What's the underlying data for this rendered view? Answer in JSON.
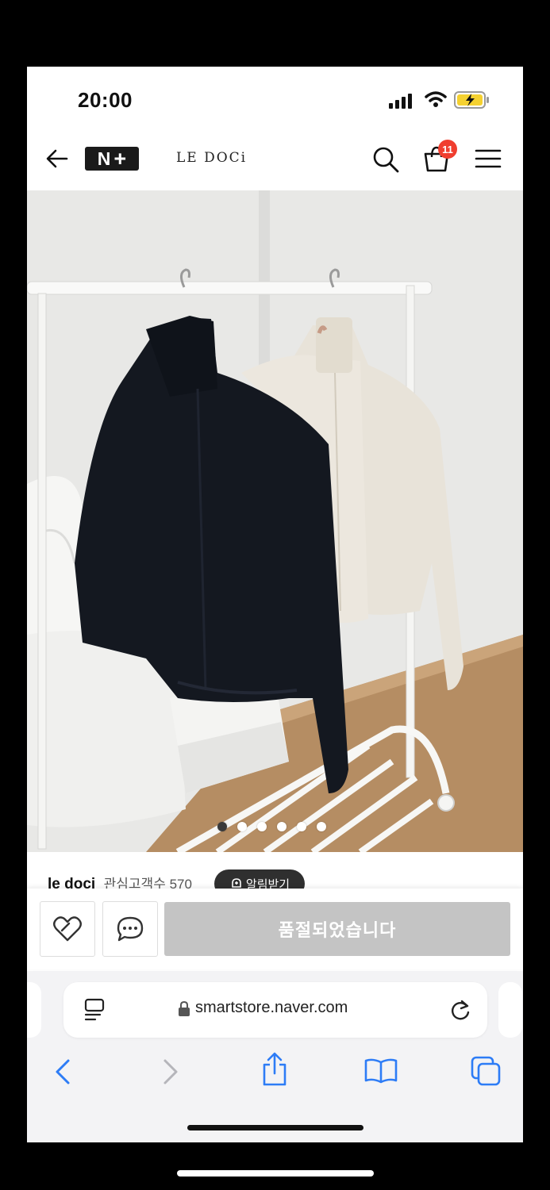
{
  "status_bar": {
    "time": "20:00",
    "battery": "charging"
  },
  "header": {
    "back_icon": "arrow-left-icon",
    "logo_n": "N",
    "logo_plus": "+",
    "brand": "LE DOCi",
    "cart_count": "11",
    "icons": [
      "search-icon",
      "cart-icon",
      "menu-icon"
    ]
  },
  "product": {
    "image_description": "navy and beige jackets on clothing rack",
    "carousel_total": 6,
    "carousel_active": 1
  },
  "seller": {
    "name": "le doci",
    "follower_label": "관심고객수 570",
    "alarm_label": "알림받기"
  },
  "purchase_bar": {
    "soldout_label": "품절되었습니다",
    "icons": [
      "heart-icon",
      "chat-icon"
    ]
  },
  "browser": {
    "url": "smartstore.naver.com",
    "icons": [
      "page-menu-icon",
      "lock-icon",
      "reload-icon",
      "back-icon",
      "forward-icon",
      "share-icon",
      "bookmarks-icon",
      "tabs-icon"
    ]
  },
  "colors": {
    "accent_badge": "#f03e2f",
    "soldout_bg": "#c4c4c4",
    "safari_blue": "#2d7cf6"
  }
}
